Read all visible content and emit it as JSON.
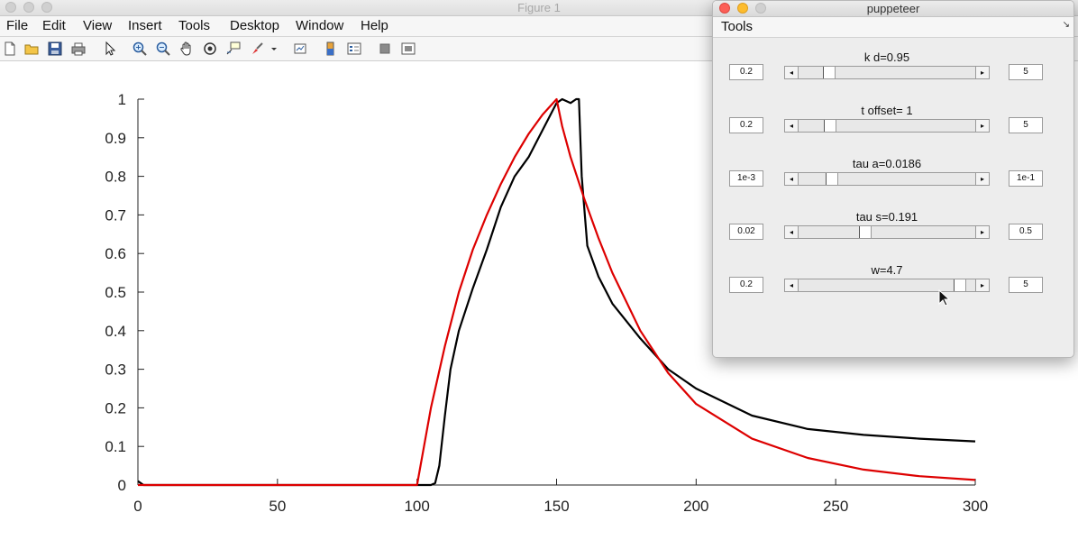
{
  "figure": {
    "title": "Figure 1",
    "menu": [
      "File",
      "Edit",
      "View",
      "Insert",
      "Tools",
      "Desktop",
      "Window",
      "Help"
    ],
    "toolbar_icons": [
      "new-figure-icon",
      "open-file-icon",
      "save-icon",
      "print-icon",
      "select-arrow-icon",
      "zoom-in-icon",
      "zoom-out-icon",
      "pan-hand-icon",
      "rotate-3d-icon",
      "data-cursor-icon",
      "brush-icon",
      "dropdown-arrow-icon",
      "link-plot-icon",
      "insert-colorbar-icon",
      "insert-legend-icon",
      "hide-plot-tools-icon",
      "show-plot-tools-icon"
    ]
  },
  "chart_data": {
    "type": "line",
    "title": "",
    "xlabel": "",
    "ylabel": "",
    "xlim": [
      0,
      300
    ],
    "ylim": [
      0,
      1
    ],
    "xticks": [
      0,
      50,
      100,
      150,
      200,
      250,
      300
    ],
    "yticks": [
      0,
      0.1,
      0.2,
      0.3,
      0.4,
      0.5,
      0.6,
      0.7,
      0.8,
      0.9,
      1
    ],
    "grid": false,
    "series": [
      {
        "color": "#000000",
        "points": [
          [
            0,
            0.01
          ],
          [
            2,
            0
          ],
          [
            105,
            0
          ],
          [
            106.5,
            0.005
          ],
          [
            108,
            0.05
          ],
          [
            110,
            0.18
          ],
          [
            112,
            0.3
          ],
          [
            115,
            0.4
          ],
          [
            120,
            0.51
          ],
          [
            125,
            0.61
          ],
          [
            130,
            0.72
          ],
          [
            135,
            0.8
          ],
          [
            140,
            0.85
          ],
          [
            145,
            0.92
          ],
          [
            150,
            0.99
          ],
          [
            152,
            1.0
          ],
          [
            155,
            0.99
          ],
          [
            157,
            1.0
          ],
          [
            158,
            1.0
          ],
          [
            159,
            0.8
          ],
          [
            161,
            0.62
          ],
          [
            165,
            0.54
          ],
          [
            170,
            0.47
          ],
          [
            180,
            0.38
          ],
          [
            190,
            0.3
          ],
          [
            200,
            0.25
          ],
          [
            220,
            0.18
          ],
          [
            240,
            0.145
          ],
          [
            260,
            0.13
          ],
          [
            280,
            0.12
          ],
          [
            300,
            0.113
          ]
        ]
      },
      {
        "color": "#dd0000",
        "points": [
          [
            0,
            0
          ],
          [
            100,
            0
          ],
          [
            105,
            0.2
          ],
          [
            110,
            0.36
          ],
          [
            115,
            0.5
          ],
          [
            120,
            0.61
          ],
          [
            125,
            0.7
          ],
          [
            130,
            0.78
          ],
          [
            135,
            0.85
          ],
          [
            140,
            0.91
          ],
          [
            145,
            0.96
          ],
          [
            150,
            1.0
          ],
          [
            152,
            0.93
          ],
          [
            155,
            0.85
          ],
          [
            160,
            0.74
          ],
          [
            165,
            0.64
          ],
          [
            170,
            0.55
          ],
          [
            180,
            0.4
          ],
          [
            190,
            0.29
          ],
          [
            200,
            0.21
          ],
          [
            220,
            0.12
          ],
          [
            240,
            0.07
          ],
          [
            260,
            0.04
          ],
          [
            280,
            0.023
          ],
          [
            300,
            0.013
          ]
        ]
      }
    ]
  },
  "puppeteer": {
    "title": "puppeteer",
    "menu_tools": "Tools",
    "dock_icon": "↘",
    "sliders": [
      {
        "label": "k d=0.95",
        "min": "0.2",
        "max": "5",
        "fraction": 0.15
      },
      {
        "label": "t offset= 1",
        "min": "0.2",
        "max": "5",
        "fraction": 0.16
      },
      {
        "label": "tau a=0.0186",
        "min": "1e-3",
        "max": "1e-1",
        "fraction": 0.17
      },
      {
        "label": "tau s=0.191",
        "min": "0.02",
        "max": "0.5",
        "fraction": 0.37
      },
      {
        "label": "w=4.7",
        "min": "0.2",
        "max": "5",
        "fraction": 0.94
      }
    ]
  }
}
